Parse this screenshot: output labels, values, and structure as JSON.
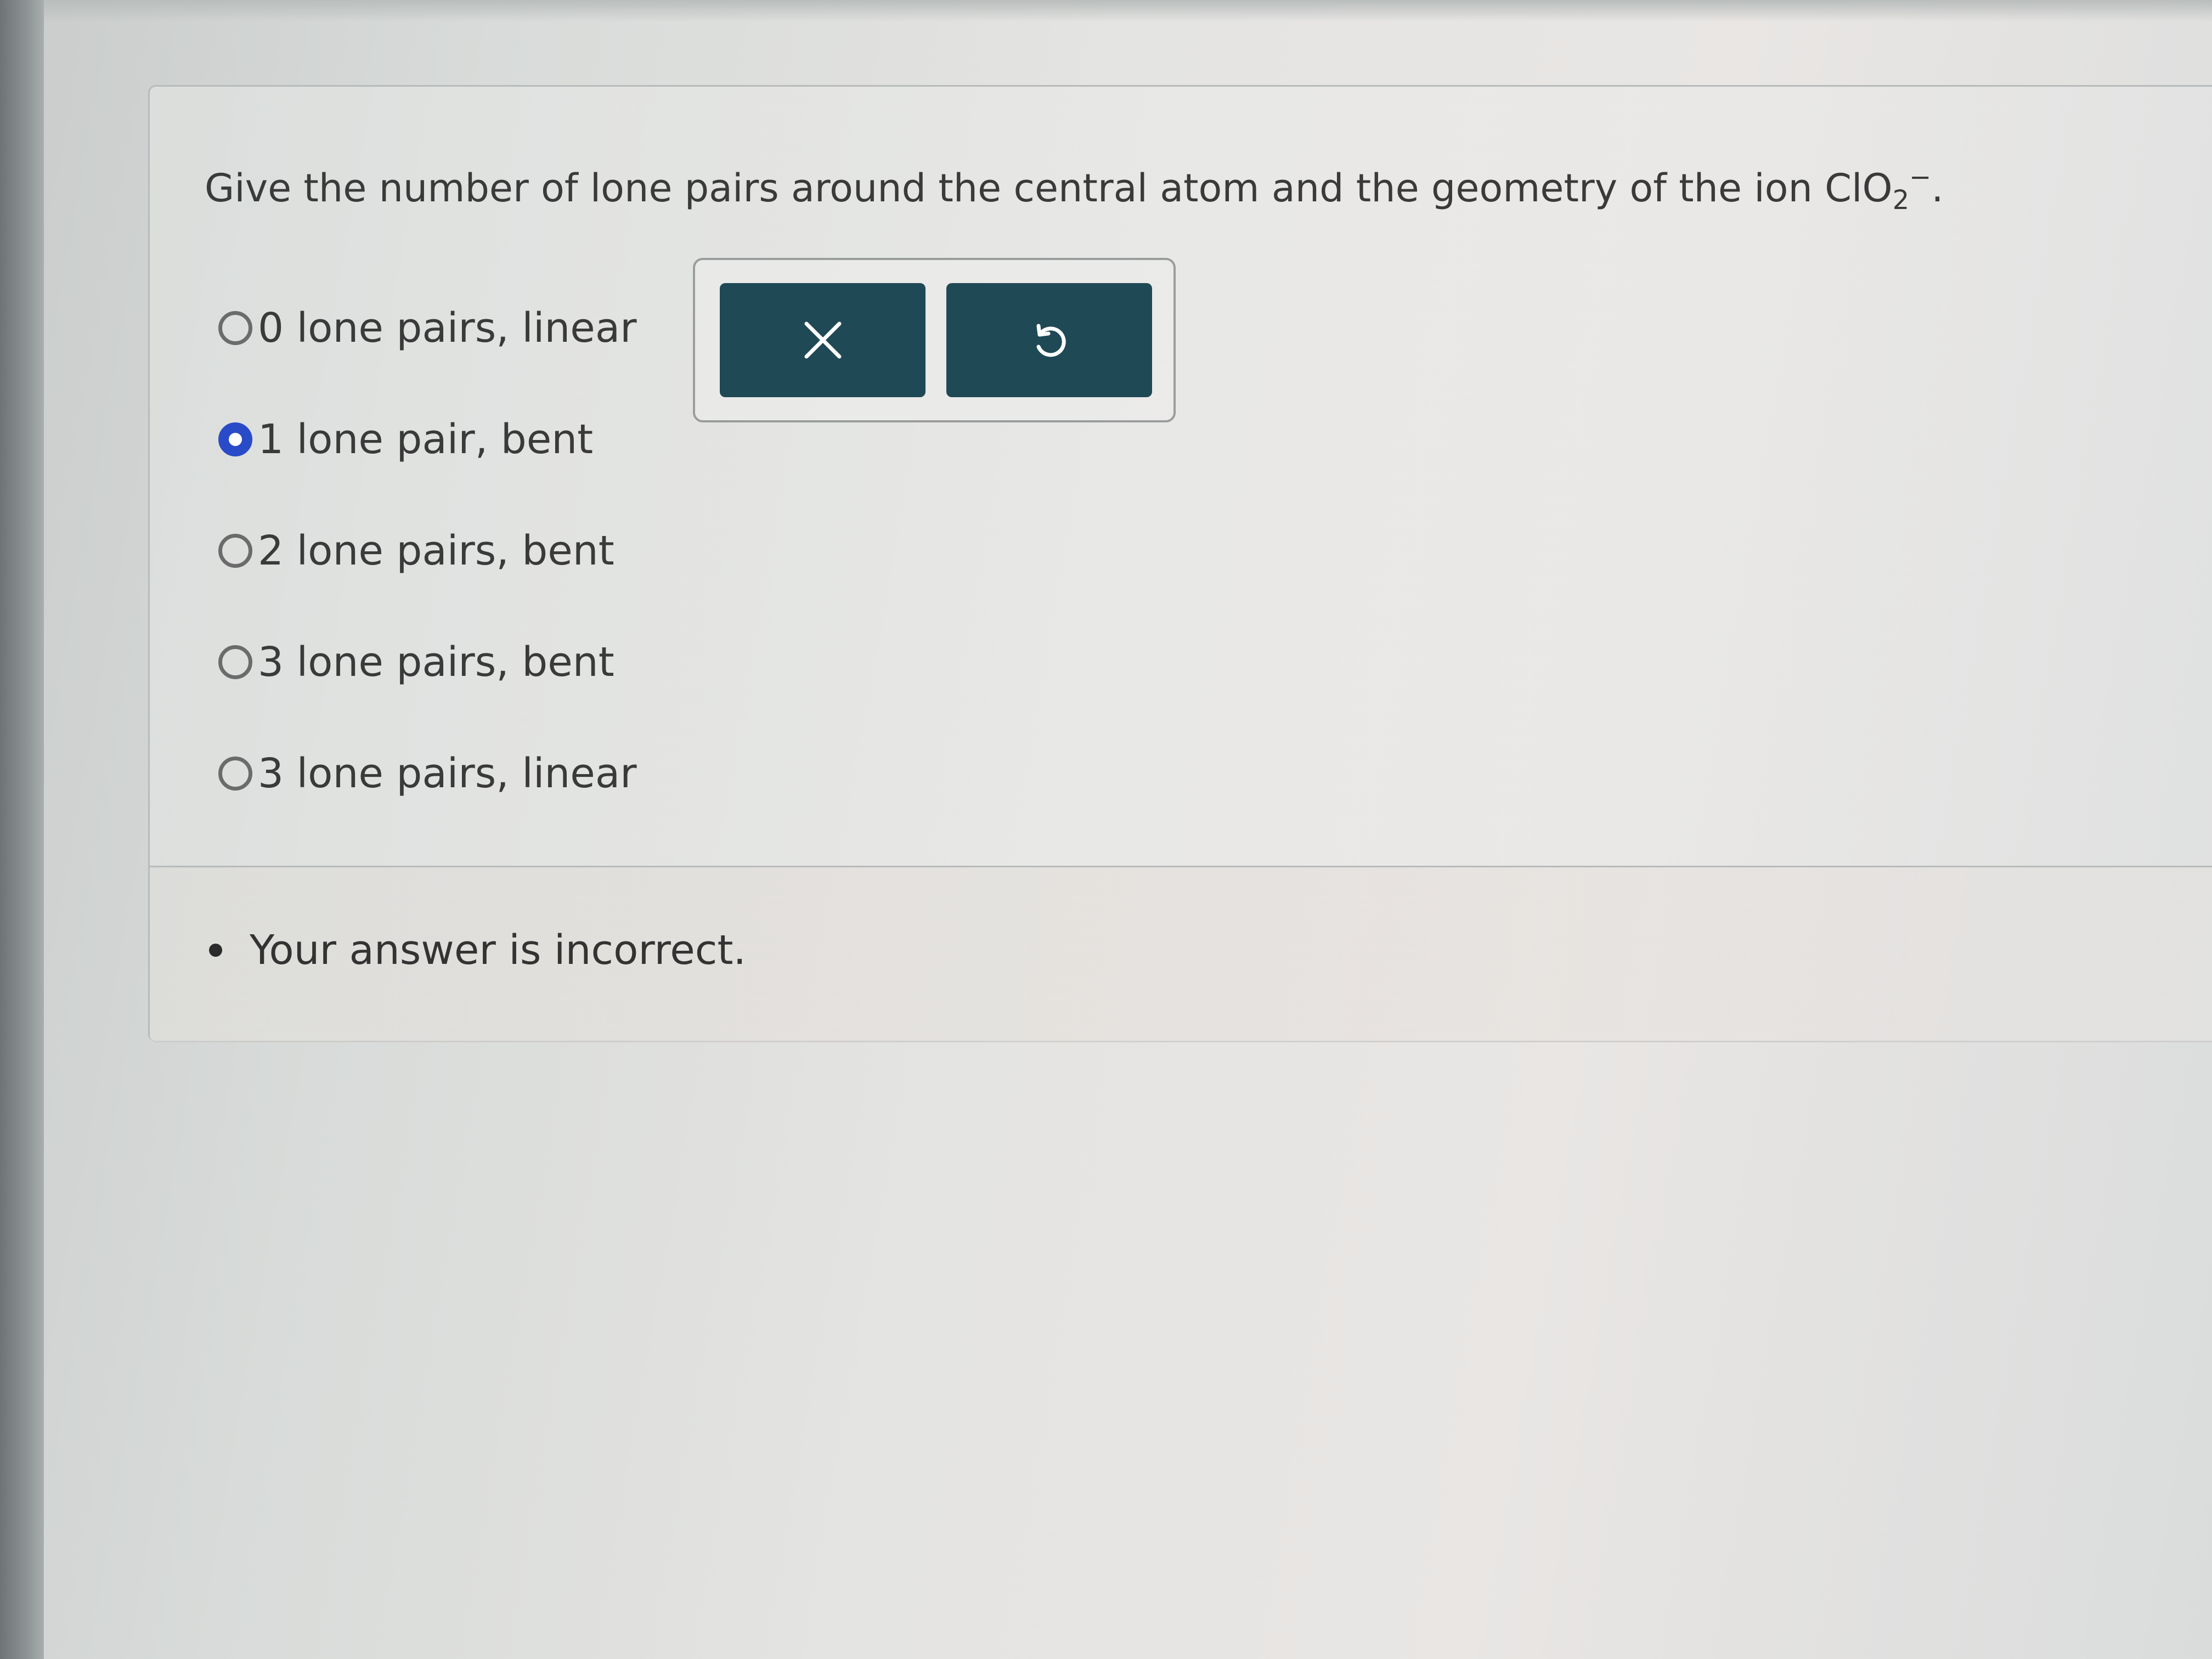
{
  "question": {
    "prefix": "Give the number of lone pairs around the central atom and the geometry of the ion ",
    "formula_main": "ClO",
    "formula_subscript": "2",
    "formula_superscript": "−",
    "suffix": "."
  },
  "options": [
    {
      "label": "0 lone pairs, linear",
      "selected": false
    },
    {
      "label": "1 lone pair, bent",
      "selected": true
    },
    {
      "label": "2 lone pairs, bent",
      "selected": false
    },
    {
      "label": "3 lone pairs, bent",
      "selected": false
    },
    {
      "label": "3 lone pairs, linear",
      "selected": false
    }
  ],
  "tools": {
    "clear_icon": "close-icon",
    "undo_icon": "undo-icon",
    "button_color": "#1f4955",
    "selected_color": "#2a4bc8"
  },
  "feedback": {
    "message": "Your answer is incorrect."
  }
}
